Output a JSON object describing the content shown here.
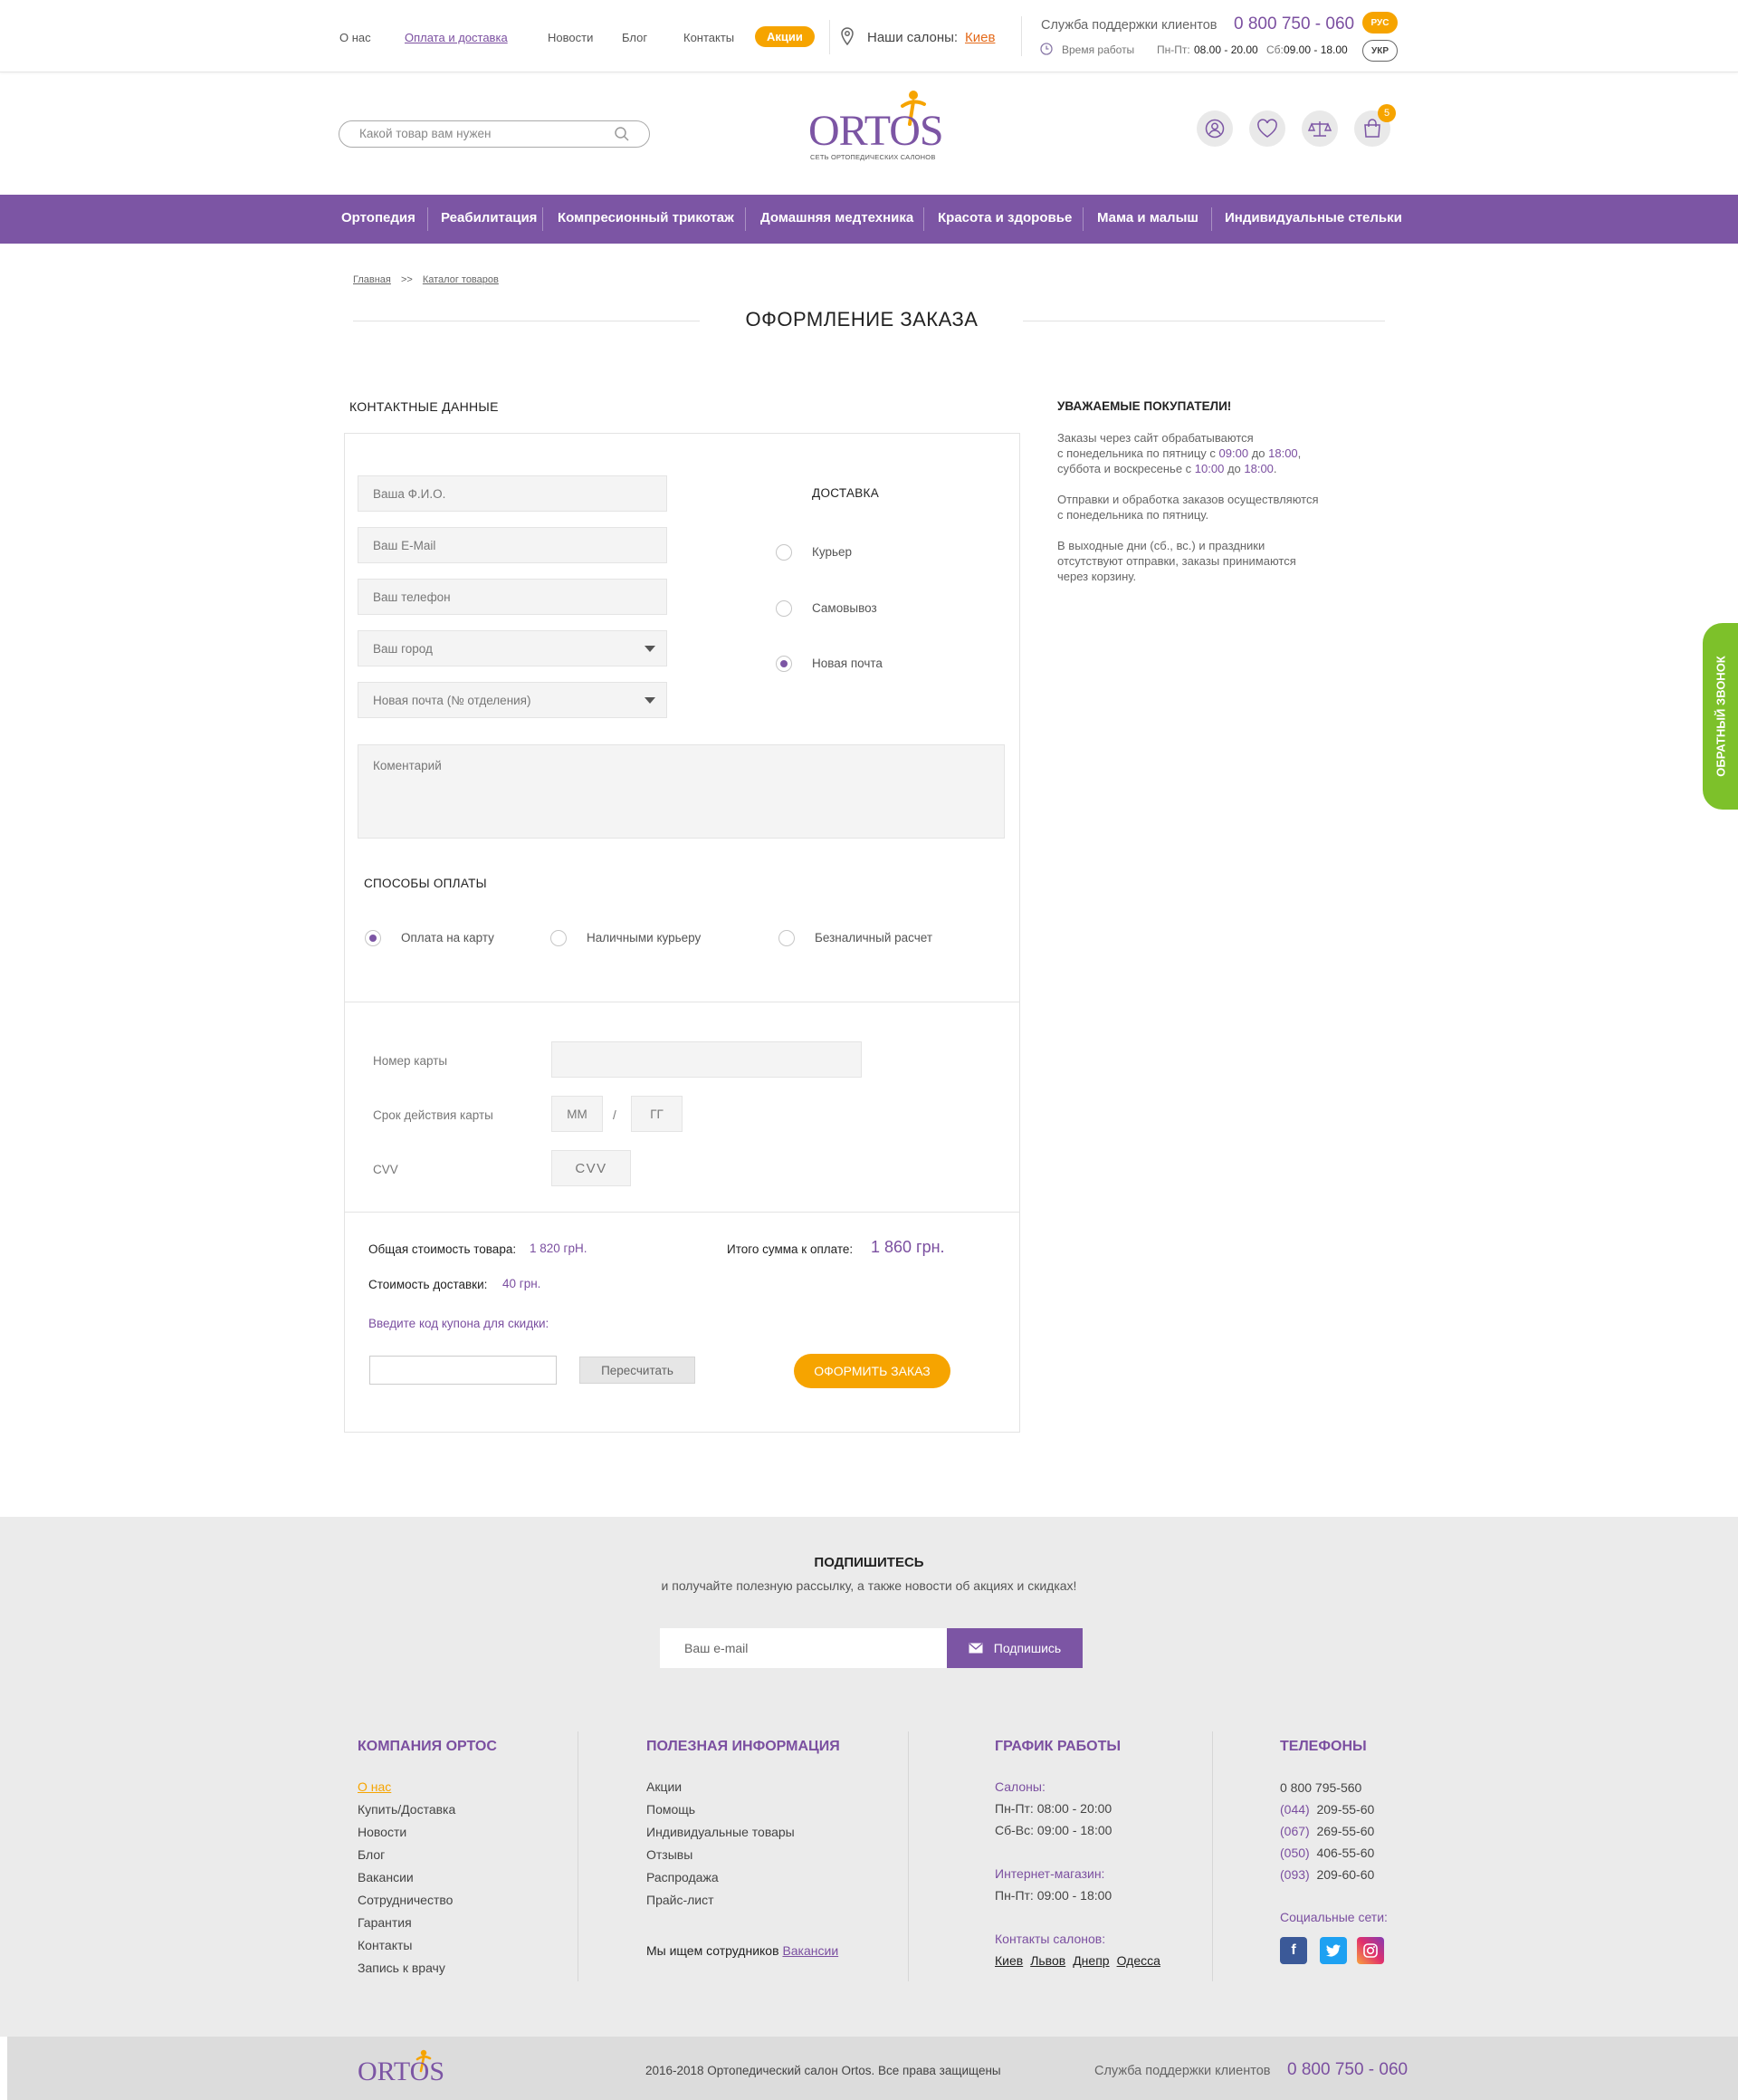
{
  "topbar": {
    "links": [
      "О нас",
      "Оплата и доставка",
      "Новости",
      "Блог",
      "Контакты"
    ],
    "promo": "Акции",
    "salons_label": "Наши салоны:",
    "city": "Киев",
    "support_label": "Служба поддержки клиентов",
    "support_phone": "0 800 750 - 060",
    "hours_label": "Время работы",
    "weekdays_label": "Пн-Пт:",
    "weekdays_hours": "08.00 - 20.00",
    "sat_label": "Сб:",
    "sat_hours": "09.00 - 18.00",
    "lang_active": "РУС",
    "lang_other": "УКР"
  },
  "header": {
    "search_placeholder": "Какой товар вам нужен",
    "logo_text": "ORTOS",
    "logo_sub": "СЕТЬ ОРТОПЕДИЧЕСКИХ САЛОНОВ",
    "cart_count": "5"
  },
  "nav": [
    "Ортопедия",
    "Реабилитация",
    "Компресионный трикотаж",
    "Домашняя медтехника",
    "Красота и здоровье",
    "Мама и малыш",
    "Индивидуальные стельки"
  ],
  "breadcrumb": {
    "home": "Главная",
    "sep": ">>",
    "current": "Каталог товаров"
  },
  "page_title": "ОФОРМЛЕНИЕ ЗАКАЗА",
  "contact": {
    "heading": "КОНТАКТНЫЕ ДАННЫЕ",
    "name_ph": "Ваша Ф.И.О.",
    "email_ph": "Ваш E-Mail",
    "phone_ph": "Ваш телефон",
    "city_ph": "Ваш город",
    "branch_ph": "Новая почта (№ отделения)",
    "comment_ph": "Коментарий"
  },
  "delivery": {
    "heading": "ДОСТАВКА",
    "options": [
      "Курьер",
      "Самовывоз",
      "Новая почта"
    ],
    "selected": "Новая почта"
  },
  "payment": {
    "heading": "СПОСОБЫ ОПЛАТЫ",
    "options": [
      "Оплата на карту",
      "Наличными курьеру",
      "Безналичный расчет"
    ],
    "selected": "Оплата на карту"
  },
  "card": {
    "number_label": "Номер карты",
    "expiry_label": "Срок действия карты",
    "mm_ph": "ММ",
    "slash": "/",
    "yy_ph": "ГГ",
    "cvv_label": "CVV",
    "cvv_ph": "CVV"
  },
  "totals": {
    "goods_label": "Общая стоимость товара:",
    "goods_value": "1 820 грН.",
    "delivery_label": "Стоимость доставки:",
    "delivery_value": "40 грн.",
    "total_label": "Итого сумма к оплате:",
    "total_value": "1 860 грн.",
    "coupon_label": "Введите код купона для скидки:",
    "recalc": "Пересчитать",
    "submit": "ОФОРМИТЬ ЗАКАЗ"
  },
  "notice": {
    "heading": "УВАЖАЕМЫЕ ПОКУПАТЕЛИ!",
    "p1a": "Заказы через сайт обрабатываются",
    "p1b": "с понедельника по пятницу с ",
    "t1": "09:00",
    "to": " до ",
    "t2": "18:00",
    "comma": ",",
    "p1c": "суббота и воскресенье с ",
    "t3": "10:00",
    "t4": "18:00",
    "dot": ".",
    "p2a": "Отправки и обработка заказов осуществляются",
    "p2b": "с понедельника по пятницу.",
    "p3a": "В выходные дни (сб., вс.) и праздники",
    "p3b": "отсутствуют отправки, заказы принимаются",
    "p3c": "через корзину."
  },
  "callback_tab": "ОБРАТНЫЙ ЗВОНОК",
  "subscribe": {
    "heading": "ПОДПИШИТЕСЬ",
    "sub": "и получайте полезную рассылку, а также новости об акциях и скидках!",
    "email_ph": "Ваш e-mail",
    "button": "Подпишись"
  },
  "footer": {
    "company_h": "КОМПАНИЯ ОРТОС",
    "company_links": [
      "О нас",
      "Купить/Доставка",
      "Новости",
      "Блог",
      "Вакансии",
      "Сотрудничество",
      "Гарантия",
      "Контакты",
      "Запись к врачу"
    ],
    "info_h": "ПОЛЕЗНАЯ ИНФОРМАЦИЯ",
    "info_links": [
      "Акции",
      "Помощь",
      "Индивидуальные товары",
      "Отзывы",
      "Распродажа",
      "Прайс-лист"
    ],
    "jobs_text": "Мы ищем сотрудников",
    "jobs_link": "Вакансии",
    "schedule_h": "ГРАФИК РАБОТЫ",
    "salons_label": "Салоны:",
    "salons_l1": "Пн-Пт: 08:00 - 20:00",
    "salons_l2": "Сб-Вс: 09:00 - 18:00",
    "shop_label": "Интернет-магазин:",
    "shop_l1": "Пн-Пт: 09:00 - 18:00",
    "contacts_label": "Контакты салонов:",
    "cities": [
      "Киев",
      "Львов",
      "Днепр",
      "Одесса"
    ],
    "phones_h": "ТЕЛЕФОНЫ",
    "phone_main": "0 800 795-560",
    "phones": [
      {
        "code": "(044)",
        "num": "209-55-60"
      },
      {
        "code": "(067)",
        "num": "269-55-60"
      },
      {
        "code": "(050)",
        "num": "406-55-60"
      },
      {
        "code": "(093)",
        "num": "209-60-60"
      }
    ],
    "social_label": "Социальные сети:",
    "copyright": "2016-2018  Ортопедический салон Ortos. Все права защищены",
    "support_label": "Служба поддержки клиентов",
    "support_phone": "0 800 750 - 060"
  },
  "colors": {
    "purple": "#7c55a4",
    "orange": "#f6a400",
    "green": "#7dc12a"
  }
}
